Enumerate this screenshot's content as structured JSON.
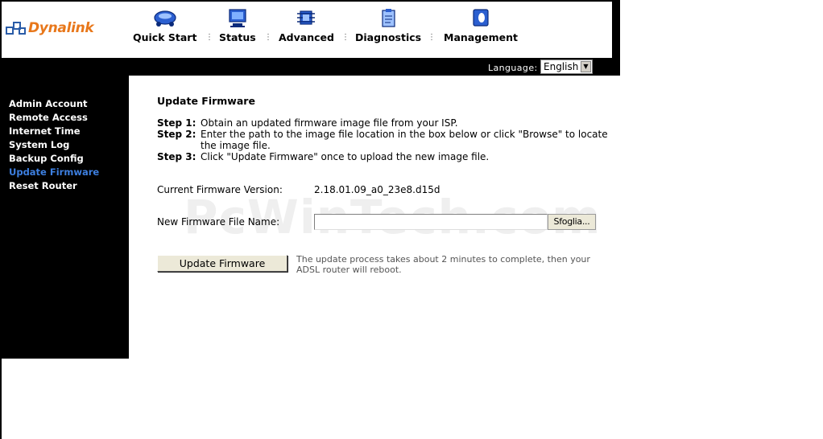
{
  "brand": {
    "name": "Dynalink",
    "color": "#e8771a"
  },
  "nav": [
    {
      "label": "Quick Start",
      "icon": "quick-start-icon"
    },
    {
      "label": "Status",
      "icon": "monitor-icon"
    },
    {
      "label": "Advanced",
      "icon": "chip-icon"
    },
    {
      "label": "Diagnostics",
      "icon": "clipboard-icon"
    },
    {
      "label": "Management",
      "icon": "management-icon"
    }
  ],
  "language": {
    "label": "Language:",
    "selected": "English"
  },
  "sidebar": {
    "items": [
      {
        "label": "Admin Account"
      },
      {
        "label": "Remote Access"
      },
      {
        "label": "Internet Time"
      },
      {
        "label": "System Log"
      },
      {
        "label": "Backup Config"
      },
      {
        "label": "Update Firmware",
        "active": true
      },
      {
        "label": "Reset Router"
      }
    ],
    "active_color": "#3d7fe0"
  },
  "main": {
    "title": "Update Firmware",
    "steps": [
      {
        "num": "Step 1:",
        "text": "Obtain an updated firmware image file from your ISP."
      },
      {
        "num": "Step 2:",
        "text": "Enter the path to the image file location in the box below or click \"Browse\" to locate the image file."
      },
      {
        "num": "Step 3:",
        "text": "Click \"Update Firmware\" once to upload the new image file."
      }
    ],
    "current_version_label": "Current Firmware Version:",
    "current_version_value": "2.18.01.09_a0_23e8.d15d",
    "file_label": "New Firmware File Name:",
    "file_value": "",
    "browse_label": "Sfoglia...",
    "update_label": "Update Firmware",
    "update_note": "The update process takes about 2 minutes to complete, then your ADSL router will reboot."
  },
  "watermark": "PcWinTech.com"
}
